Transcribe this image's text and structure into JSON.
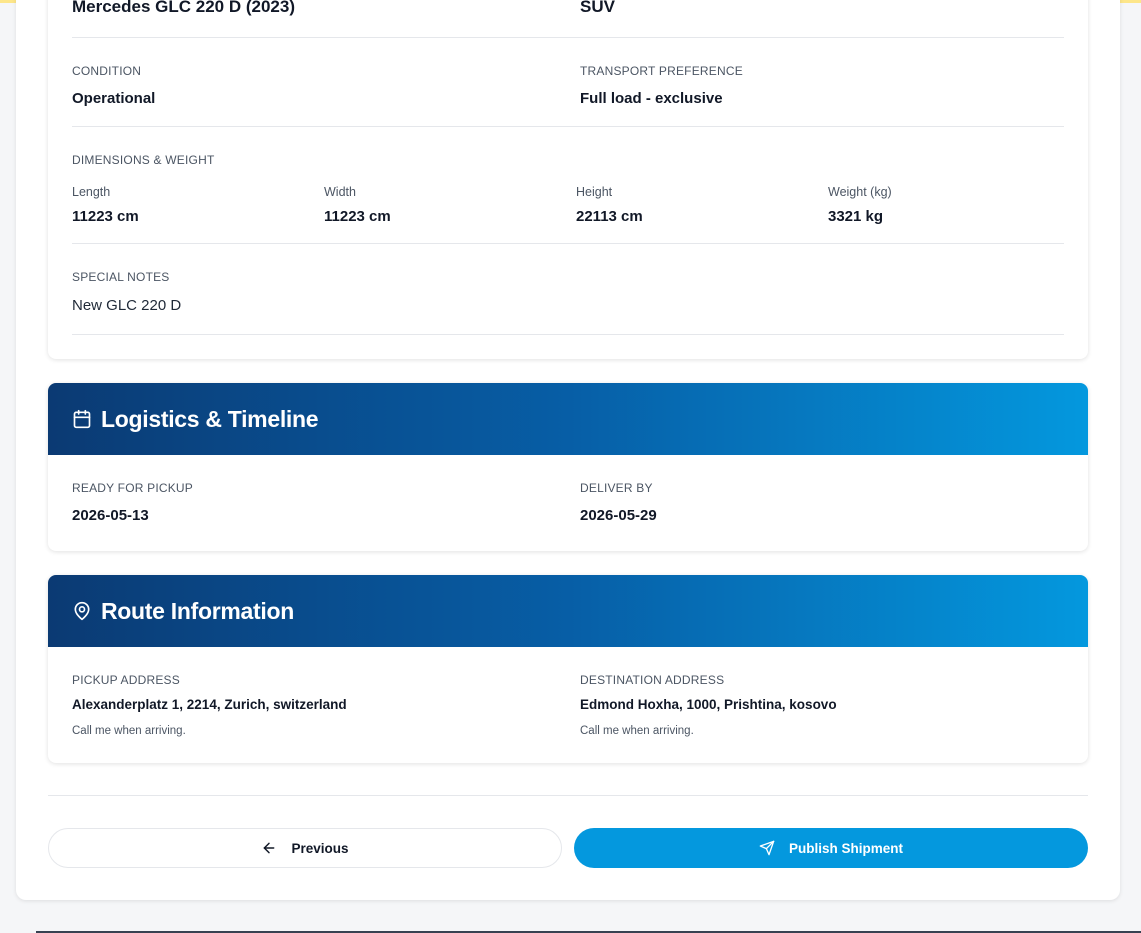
{
  "vehicle": {
    "model_value": "Mercedes GLC 220 D (2023)",
    "type_value": "SUV",
    "condition_label": "CONDITION",
    "condition_value": "Operational",
    "transport_label": "TRANSPORT PREFERENCE",
    "transport_value": "Full load - exclusive",
    "dimensions_label": "DIMENSIONS & WEIGHT",
    "dimensions": [
      {
        "label": "Length",
        "value": "11223 cm"
      },
      {
        "label": "Width",
        "value": "11223 cm"
      },
      {
        "label": "Height",
        "value": "22113 cm"
      },
      {
        "label": "Weight (kg)",
        "value": "3321 kg"
      }
    ],
    "notes_label": "SPECIAL NOTES",
    "notes_value": "New GLC 220 D"
  },
  "logistics": {
    "title": "Logistics & Timeline",
    "icon": "calendar-icon",
    "pickup_label": "READY FOR PICKUP",
    "pickup_value": "2026-05-13",
    "deliver_label": "DELIVER BY",
    "deliver_value": "2026-05-29"
  },
  "route": {
    "title": "Route Information",
    "icon": "map-pin-icon",
    "pickup_label": "PICKUP ADDRESS",
    "pickup_address": "Alexanderplatz 1, 2214, Zurich, switzerland",
    "pickup_note": "Call me when arriving.",
    "destination_label": "DESTINATION ADDRESS",
    "destination_address": "Edmond Hoxha, 1000, Prishtina, kosovo",
    "destination_note": "Call me when arriving."
  },
  "actions": {
    "previous_label": "Previous",
    "previous_icon": "arrow-left-icon",
    "publish_label": "Publish Shipment",
    "publish_icon": "send-icon"
  },
  "colors": {
    "header_gradient_start": "#0b3a73",
    "header_gradient_end": "#0498de",
    "primary_button": "#0498de"
  }
}
